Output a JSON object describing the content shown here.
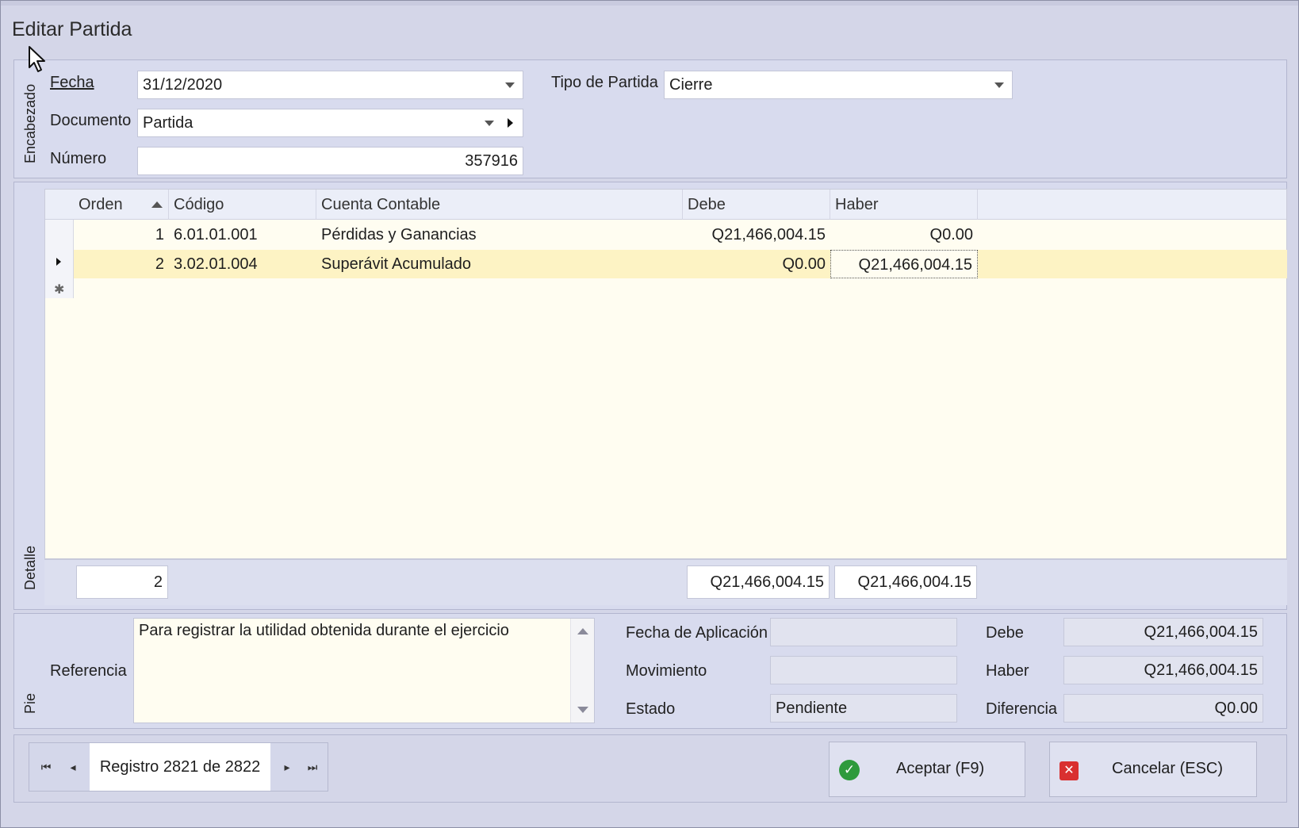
{
  "window": {
    "title": "Editar Partida"
  },
  "header": {
    "section_label": "Encabezado",
    "fecha_label": "Fecha",
    "fecha_value": "31/12/2020",
    "tipo_label": "Tipo de Partida",
    "tipo_value": "Cierre",
    "documento_label": "Documento",
    "documento_value": "Partida",
    "numero_label": "Número",
    "numero_value": "357916"
  },
  "detail": {
    "section_label": "Detalle",
    "columns": [
      "Orden",
      "Código",
      "Cuenta Contable",
      "Debe",
      "Haber"
    ],
    "rows": [
      {
        "orden": "1",
        "codigo": "6.01.01.001",
        "cuenta": "Pérdidas y Ganancias",
        "debe": "Q21,466,004.15",
        "haber": "Q0.00"
      },
      {
        "orden": "2",
        "codigo": "3.02.01.004",
        "cuenta": "Superávit Acumulado",
        "debe": "Q0.00",
        "haber": "Q21,466,004.15"
      }
    ],
    "footer": {
      "count": "2",
      "total_debe": "Q21,466,004.15",
      "total_haber": "Q21,466,004.15"
    }
  },
  "footer": {
    "section_label": "Pie",
    "referencia_label": "Referencia",
    "referencia_value": "Para registrar la utilidad obtenida durante el ejercicio",
    "fecha_aplicacion_label": "Fecha de Aplicación",
    "fecha_aplicacion_value": "",
    "movimiento_label": "Movimiento",
    "movimiento_value": "",
    "estado_label": "Estado",
    "estado_value": "Pendiente",
    "debe_label": "Debe",
    "debe_value": "Q21,466,004.15",
    "haber_label": "Haber",
    "haber_value": "Q21,466,004.15",
    "diferencia_label": "Diferencia",
    "diferencia_value": "Q0.00"
  },
  "navigator": {
    "text": "Registro 2821 de 2822"
  },
  "buttons": {
    "accept_label": "Aceptar (F9)",
    "cancel_label": "Cancelar (ESC)"
  },
  "colors": {
    "selected_row": "#fdf3c4",
    "grid_bg": "#fffdf1",
    "accept_icon": "#2e9a3c",
    "cancel_icon": "#d93030"
  }
}
